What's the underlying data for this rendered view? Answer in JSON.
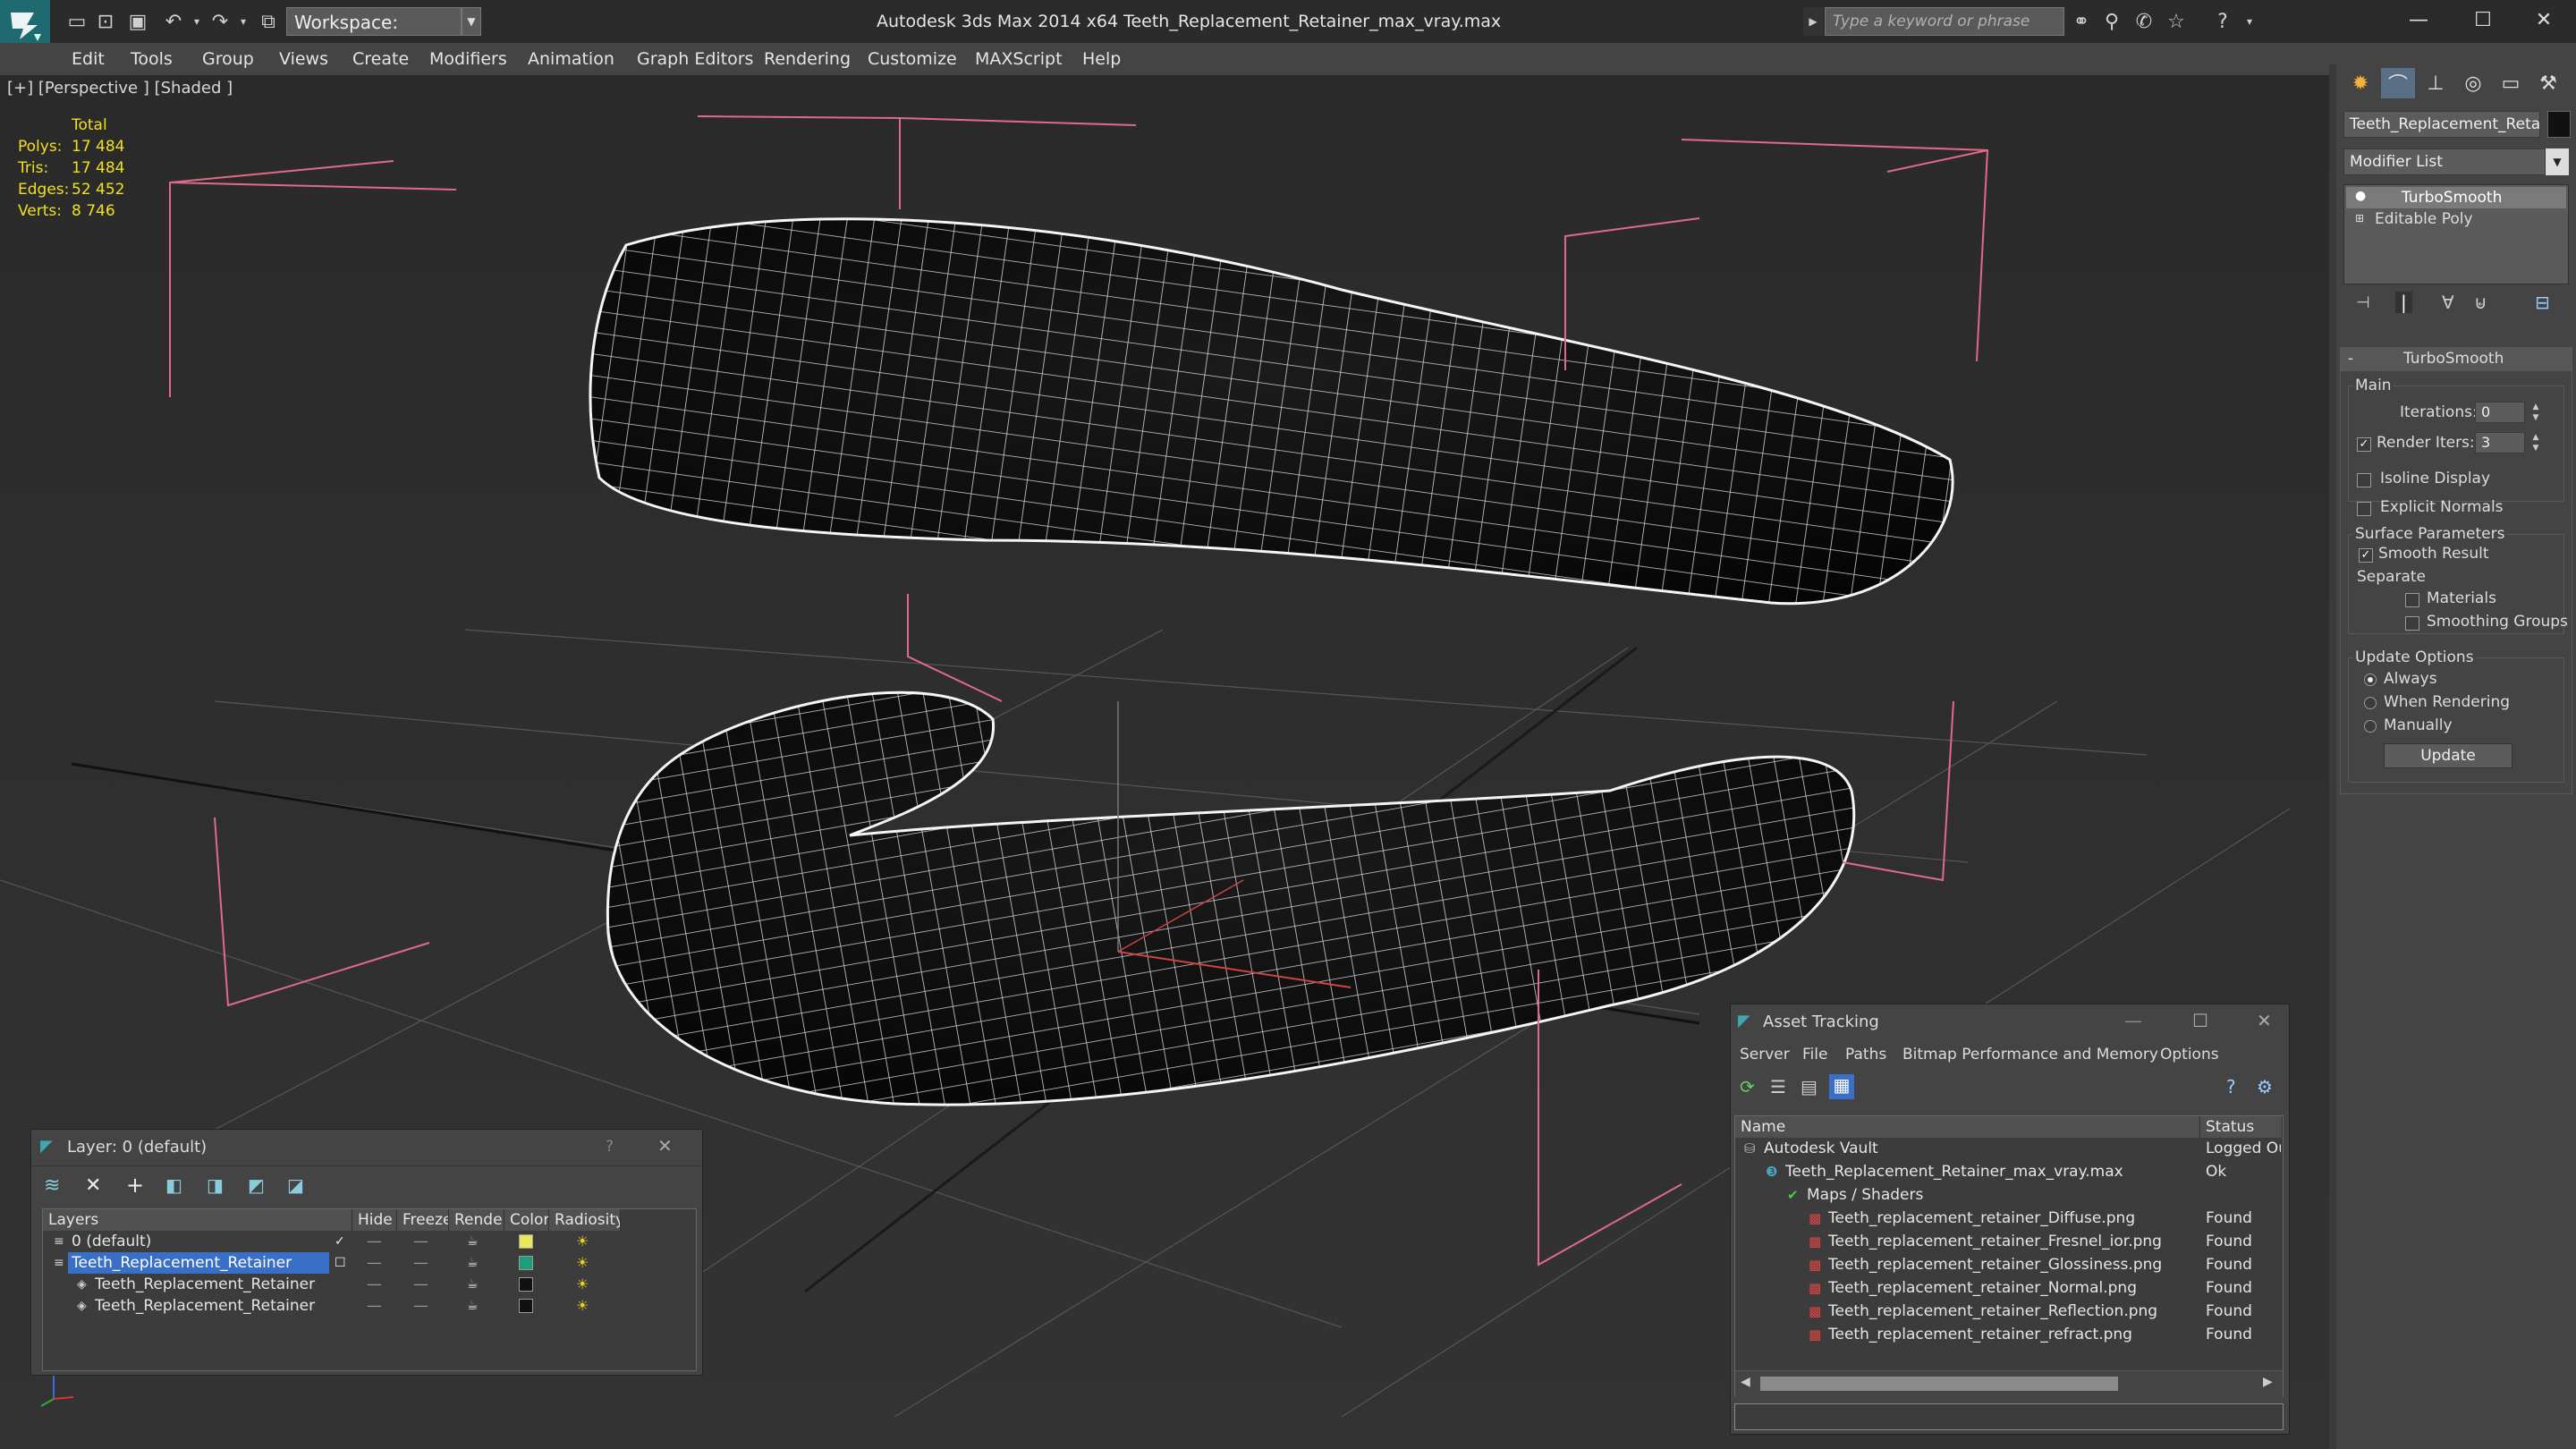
{
  "app": {
    "title": "Autodesk 3ds Max  2014 x64      Teeth_Replacement_Retainer_max_vray.max",
    "workspace": "Workspace: Default",
    "search_placeholder": "Type a keyword or phrase"
  },
  "menu": [
    "Edit",
    "Tools",
    "Group",
    "Views",
    "Create",
    "Modifiers",
    "Animation",
    "Graph Editors",
    "Rendering",
    "Customize",
    "MAXScript",
    "Help"
  ],
  "viewport": {
    "label": "[+] [Perspective ] [Shaded ]",
    "stats": {
      "total": "Total",
      "rows": [
        {
          "label": "Polys:",
          "value": "17 484"
        },
        {
          "label": "Tris:",
          "value": "17 484"
        },
        {
          "label": "Edges:",
          "value": "52 452"
        },
        {
          "label": "Verts:",
          "value": "8 746"
        }
      ]
    }
  },
  "command_panel": {
    "object_name": "Teeth_Replacement_Retainer",
    "modifier_list": "Modifier List",
    "stack": [
      "TurboSmooth",
      "Editable Poly"
    ],
    "rollout_title": "TurboSmooth",
    "main_label": "Main",
    "iterations_label": "Iterations:",
    "iterations_value": "0",
    "render_iters_label": "Render Iters:",
    "render_iters_value": "3",
    "isoline_display": "Isoline Display",
    "explicit_normals": "Explicit Normals",
    "surface_parameters": "Surface Parameters",
    "smooth_result": "Smooth Result",
    "separate": "Separate",
    "materials": "Materials",
    "smoothing_groups": "Smoothing Groups",
    "update_options": "Update Options",
    "always": "Always",
    "when_rendering": "When Rendering",
    "manually": "Manually",
    "update_button": "Update"
  },
  "layer_window": {
    "title": "Layer: 0 (default)",
    "help": "?",
    "columns": [
      "Layers",
      "Hide",
      "Freeze",
      "Render",
      "Color",
      "Radiosity"
    ],
    "rows": [
      {
        "name": "0 (default)",
        "color": "#e8e85a",
        "selected": false,
        "indent": 0
      },
      {
        "name": "Teeth_Replacement_Retainer",
        "color": "#1c9e7a",
        "selected": true,
        "indent": 0
      },
      {
        "name": "Teeth_Replacement_Retainer",
        "color": "#111111",
        "selected": false,
        "indent": 1
      },
      {
        "name": "Teeth_Replacement_Retainer",
        "color": "#111111",
        "selected": false,
        "indent": 1
      }
    ]
  },
  "asset_window": {
    "title": "Asset Tracking",
    "menu": [
      "Server",
      "File",
      "Paths",
      "Bitmap Performance and Memory",
      "Options"
    ],
    "columns": [
      "Name",
      "Status"
    ],
    "rows": [
      {
        "name": "Autodesk Vault",
        "status": "Logged Out",
        "indent": 0,
        "icon": "vault"
      },
      {
        "name": "Teeth_Replacement_Retainer_max_vray.max",
        "status": "Ok",
        "indent": 1,
        "icon": "max"
      },
      {
        "name": "Maps / Shaders",
        "status": "",
        "indent": 2,
        "icon": "maps"
      },
      {
        "name": "Teeth_replacement_retainer_Diffuse.png",
        "status": "Found",
        "indent": 3,
        "icon": "png"
      },
      {
        "name": "Teeth_replacement_retainer_Fresnel_ior.png",
        "status": "Found",
        "indent": 3,
        "icon": "png"
      },
      {
        "name": "Teeth_replacement_retainer_Glossiness.png",
        "status": "Found",
        "indent": 3,
        "icon": "png"
      },
      {
        "name": "Teeth_replacement_retainer_Normal.png",
        "status": "Found",
        "indent": 3,
        "icon": "png"
      },
      {
        "name": "Teeth_replacement_retainer_Reflection.png",
        "status": "Found",
        "indent": 3,
        "icon": "png"
      },
      {
        "name": "Teeth_replacement_retainer_refract.png",
        "status": "Found",
        "indent": 3,
        "icon": "png"
      }
    ]
  }
}
